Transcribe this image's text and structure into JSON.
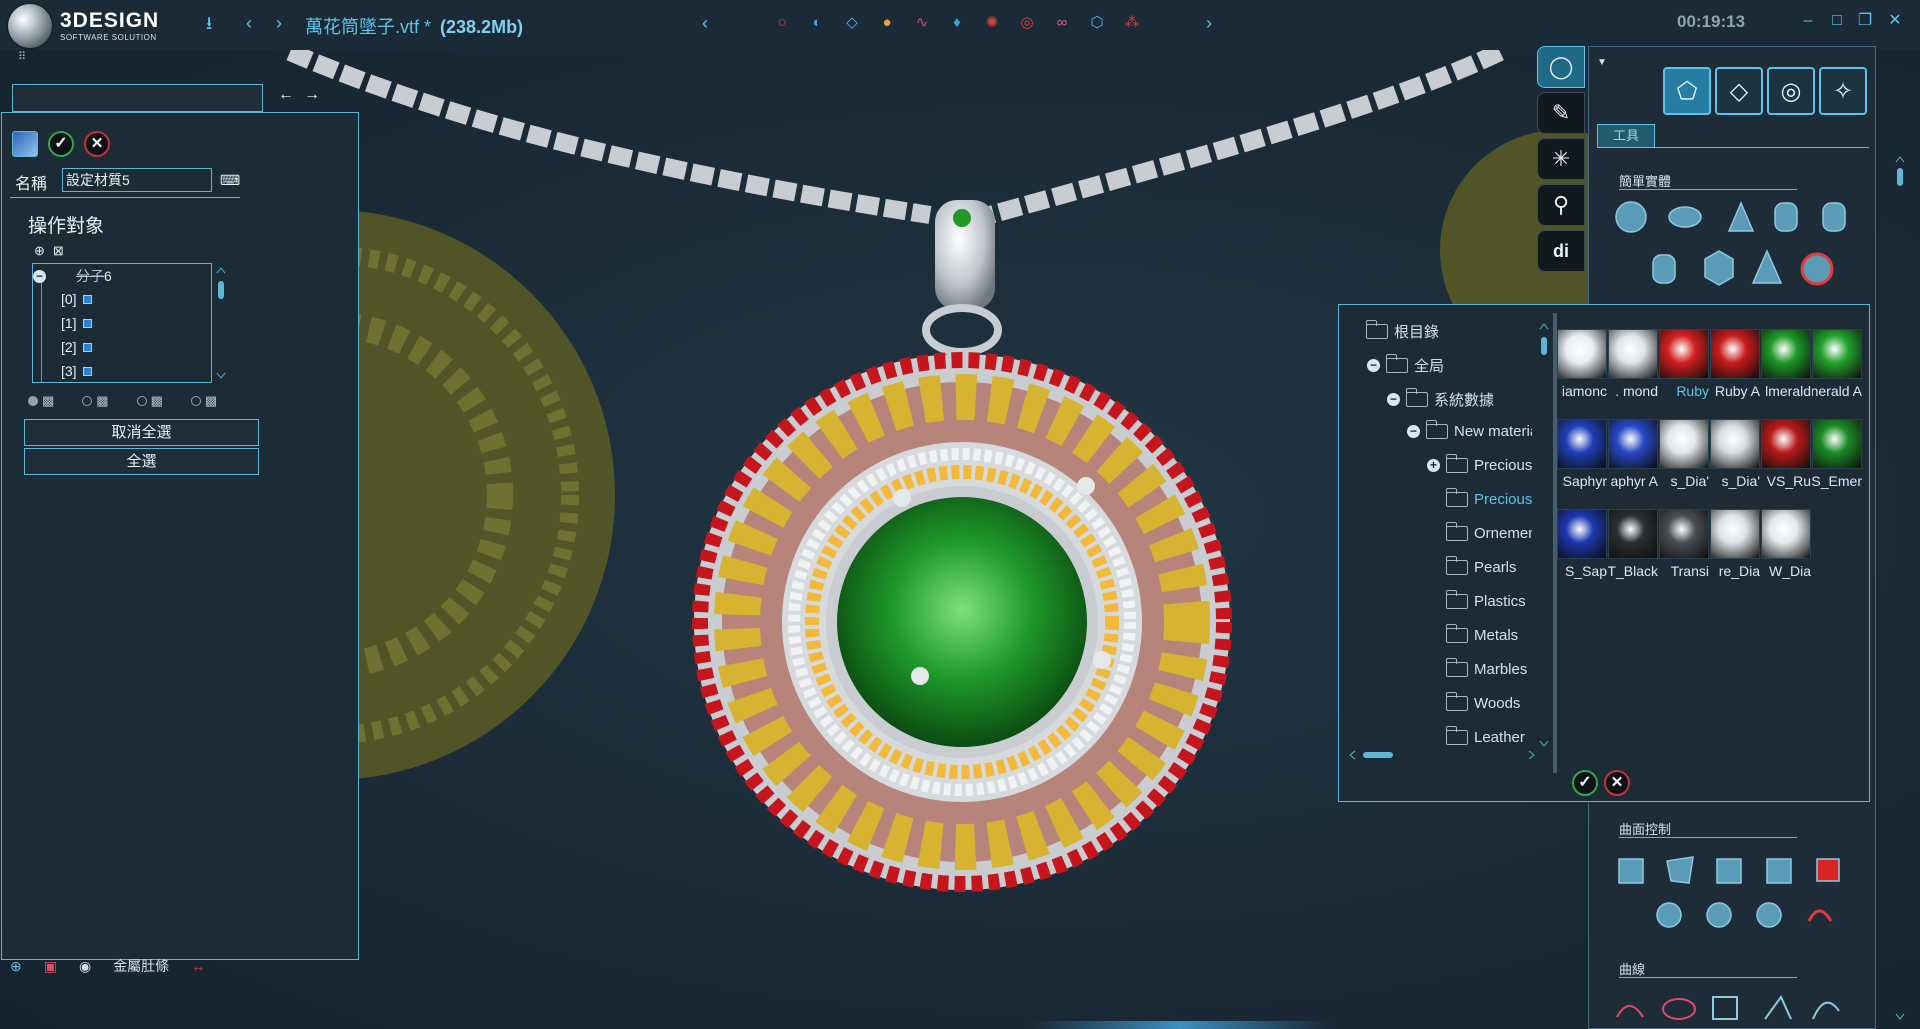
{
  "app": {
    "logo_main": "3DESIGN",
    "logo_sub": "SOFTWARE SOLUTION",
    "file_title": "萬花筒墜子.vtf *",
    "file_size": "(238.2Mb)",
    "timer": "00:19:13"
  },
  "left_panel": {
    "name_label": "名稱",
    "name_value": "設定材質5",
    "operation_title": "操作對象",
    "tree_parent": "分子",
    "tree_parent_count": "6",
    "tree_items": [
      "[0]",
      "[1]",
      "[2]",
      "[3]"
    ],
    "deselect_all": "取消全選",
    "select_all": "全選"
  },
  "bottom_strip": {
    "label": "金屬肚條"
  },
  "right_panel": {
    "tab_label": "工具",
    "section_simple_solids": "簡單實體",
    "section_surface_control": "曲面控制",
    "section_curves": "曲線"
  },
  "material_dialog": {
    "folders": [
      {
        "label": "根目錄",
        "level": 0,
        "toggle": ""
      },
      {
        "label": "全局",
        "level": 1,
        "toggle": "−"
      },
      {
        "label": "系統數據",
        "level": 2,
        "toggle": "−"
      },
      {
        "label": "New materia",
        "level": 3,
        "toggle": "−"
      },
      {
        "label": "Precious m",
        "level": 4,
        "toggle": "+"
      },
      {
        "label": "Precious s",
        "level": 4,
        "toggle": "",
        "selected": true
      },
      {
        "label": "Ornement",
        "level": 4,
        "toggle": ""
      },
      {
        "label": "Pearls",
        "level": 4,
        "toggle": ""
      },
      {
        "label": "Plastics",
        "level": 4,
        "toggle": ""
      },
      {
        "label": "Metals",
        "level": 4,
        "toggle": ""
      },
      {
        "label": "Marbles",
        "level": 4,
        "toggle": ""
      },
      {
        "label": "Woods",
        "level": 4,
        "toggle": ""
      },
      {
        "label": "Leather",
        "level": 4,
        "toggle": ""
      }
    ],
    "gems": [
      {
        "label": "iamonc",
        "color": "#e9eef2"
      },
      {
        "label": "mond .",
        "color": "#dfe5ea"
      },
      {
        "label": "Ruby",
        "color": "#d42020",
        "selected": true
      },
      {
        "label": "Ruby A",
        "color": "#c81b1b"
      },
      {
        "label": "lmerald",
        "color": "#1d9a28"
      },
      {
        "label": "nerald A",
        "color": "#23a32e"
      },
      {
        "label": "Saphyr",
        "color": "#1f3fb8"
      },
      {
        "label": "aphyr A",
        "color": "#2747c4"
      },
      {
        "label": "'s_Dia",
        "color": "#e2e7eb"
      },
      {
        "label": "'s_Dia",
        "color": "#d7dde2"
      },
      {
        "label": "VS_Ru",
        "color": "#b81a1a"
      },
      {
        "label": "S_Emer",
        "color": "#1c8b26"
      },
      {
        "label": "S_Sap",
        "color": "#1d37b0"
      },
      {
        "label": "T_Black",
        "color": "#2b2f33"
      },
      {
        "label": "Transi",
        "color": "#4a4f54"
      },
      {
        "label": "re_Dia",
        "color": "#dde3e8"
      },
      {
        "label": "W_Dia",
        "color": "#e4e9ed"
      }
    ]
  },
  "colors": {
    "accent": "#5fc4e8",
    "panel_border": "#5fb7d6",
    "background": "#1a2a36",
    "ok_green": "#2fa84a",
    "cancel_red": "#c43434"
  }
}
